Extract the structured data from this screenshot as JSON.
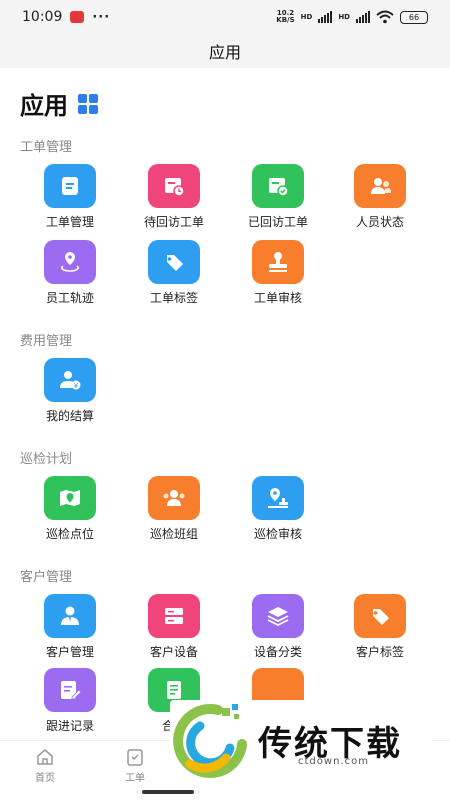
{
  "status": {
    "time": "10:09",
    "dots": "···",
    "speed": "10.2",
    "speed_unit": "KB/S",
    "network1": "HD",
    "network2": "HD",
    "battery": "66"
  },
  "header": {
    "title": "应用"
  },
  "page": {
    "heading": "应用"
  },
  "sections": [
    {
      "title": "工单管理",
      "apps": [
        {
          "label": "工单管理",
          "color": "#2e9ff0",
          "icon": "form-icon"
        },
        {
          "label": "待回访工单",
          "color": "#f0457a",
          "icon": "calendar-clock-icon"
        },
        {
          "label": "已回访工单",
          "color": "#32c25b",
          "icon": "calendar-check-icon"
        },
        {
          "label": "人员状态",
          "color": "#f67e2c",
          "icon": "people-icon"
        },
        {
          "label": "员工轨迹",
          "color": "#9b6bf0",
          "icon": "route-pin-icon"
        },
        {
          "label": "工单标签",
          "color": "#2e9ff0",
          "icon": "tag-icon"
        },
        {
          "label": "工单审核",
          "color": "#f67e2c",
          "icon": "stamp-icon"
        }
      ]
    },
    {
      "title": "费用管理",
      "apps": [
        {
          "label": "我的结算",
          "color": "#2e9ff0",
          "icon": "user-money-icon"
        }
      ]
    },
    {
      "title": "巡检计划",
      "apps": [
        {
          "label": "巡检点位",
          "color": "#32c25b",
          "icon": "map-pin-icon"
        },
        {
          "label": "巡检班组",
          "color": "#f67e2c",
          "icon": "group-icon"
        },
        {
          "label": "巡检审核",
          "color": "#2e9ff0",
          "icon": "location-stamp-icon"
        }
      ]
    },
    {
      "title": "客户管理",
      "apps": [
        {
          "label": "客户管理",
          "color": "#2e9ff0",
          "icon": "customer-icon"
        },
        {
          "label": "客户设备",
          "color": "#f0457a",
          "icon": "server-icon"
        },
        {
          "label": "设备分类",
          "color": "#9b6bf0",
          "icon": "layers-icon"
        },
        {
          "label": "客户标签",
          "color": "#f67e2c",
          "icon": "tag-icon"
        },
        {
          "label": "跟进记录",
          "color": "#9b6bf0",
          "icon": "edit-note-icon"
        },
        {
          "label": "合同",
          "color": "#32c25b",
          "icon": "contract-icon"
        }
      ]
    }
  ],
  "nav": [
    {
      "label": "首页",
      "icon": "home-icon"
    },
    {
      "label": "工单",
      "icon": "clipboard-check-icon"
    }
  ],
  "watermark": {
    "text": "传统下载",
    "url": "ctdown.com"
  }
}
